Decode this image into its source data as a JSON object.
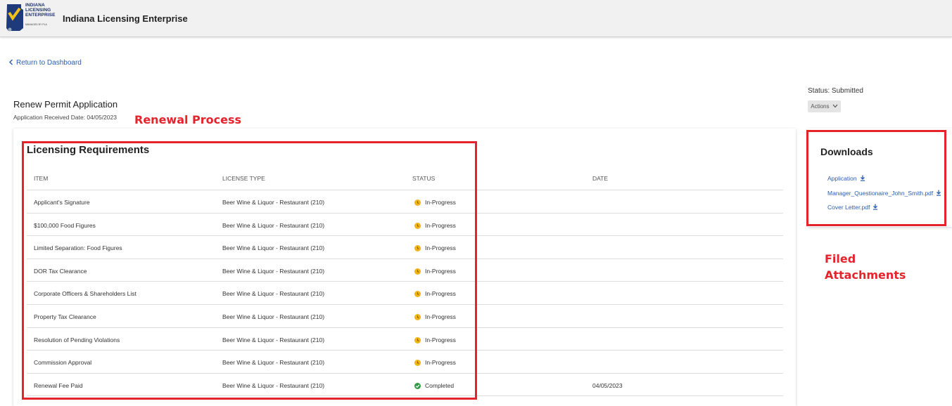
{
  "header": {
    "logo_lines": [
      "INDIANA",
      "LICENSING",
      "ENTERPRISE"
    ],
    "logo_sub": "MANAGED BY PLA",
    "title": "Indiana Licensing Enterprise"
  },
  "nav": {
    "back_label": "Return to Dashboard"
  },
  "page": {
    "title": "Renew Permit Application",
    "received": "Application Received Date: 04/05/2023",
    "status": "Status: Submitted",
    "actions_label": "Actions"
  },
  "annotations": {
    "renewal": "Renewal Process",
    "filed_line1": "Filed",
    "filed_line2": "Attachments"
  },
  "requirements": {
    "heading": "Licensing Requirements",
    "columns": [
      "ITEM",
      "LICENSE TYPE",
      "STATUS",
      "DATE"
    ],
    "rows": [
      {
        "item": "Applicant's Signature",
        "license": "Beer Wine & Liquor - Restaurant (210)",
        "status": "In-Progress",
        "date": ""
      },
      {
        "item": "$100,000 Food Figures",
        "license": "Beer Wine & Liquor - Restaurant (210)",
        "status": "In-Progress",
        "date": ""
      },
      {
        "item": "Limited Separation: Food Figures",
        "license": "Beer Wine & Liquor - Restaurant (210)",
        "status": "In-Progress",
        "date": ""
      },
      {
        "item": "DOR Tax Clearance",
        "license": "Beer Wine & Liquor - Restaurant (210)",
        "status": "In-Progress",
        "date": ""
      },
      {
        "item": "Corporate Officers & Shareholders List",
        "license": "Beer Wine & Liquor - Restaurant (210)",
        "status": "In-Progress",
        "date": ""
      },
      {
        "item": "Property Tax Clearance",
        "license": "Beer Wine & Liquor - Restaurant (210)",
        "status": "In-Progress",
        "date": ""
      },
      {
        "item": "Resolution of Pending Violations",
        "license": "Beer Wine & Liquor - Restaurant (210)",
        "status": "In-Progress",
        "date": ""
      },
      {
        "item": "Commission Approval",
        "license": "Beer Wine & Liquor - Restaurant (210)",
        "status": "In-Progress",
        "date": ""
      },
      {
        "item": "Renewal Fee Paid",
        "license": "Beer Wine & Liquor - Restaurant (210)",
        "status": "Completed",
        "date": "04/05/2023"
      }
    ]
  },
  "downloads": {
    "heading": "Downloads",
    "files": [
      "Application",
      "Manager_Questionaire_John_Smith.pdf",
      "Cover Letter.pdf"
    ]
  },
  "colors": {
    "link": "#2a5db0",
    "annotation": "#e4232b",
    "in_progress": "#f2b21a",
    "completed": "#2e9b43"
  }
}
